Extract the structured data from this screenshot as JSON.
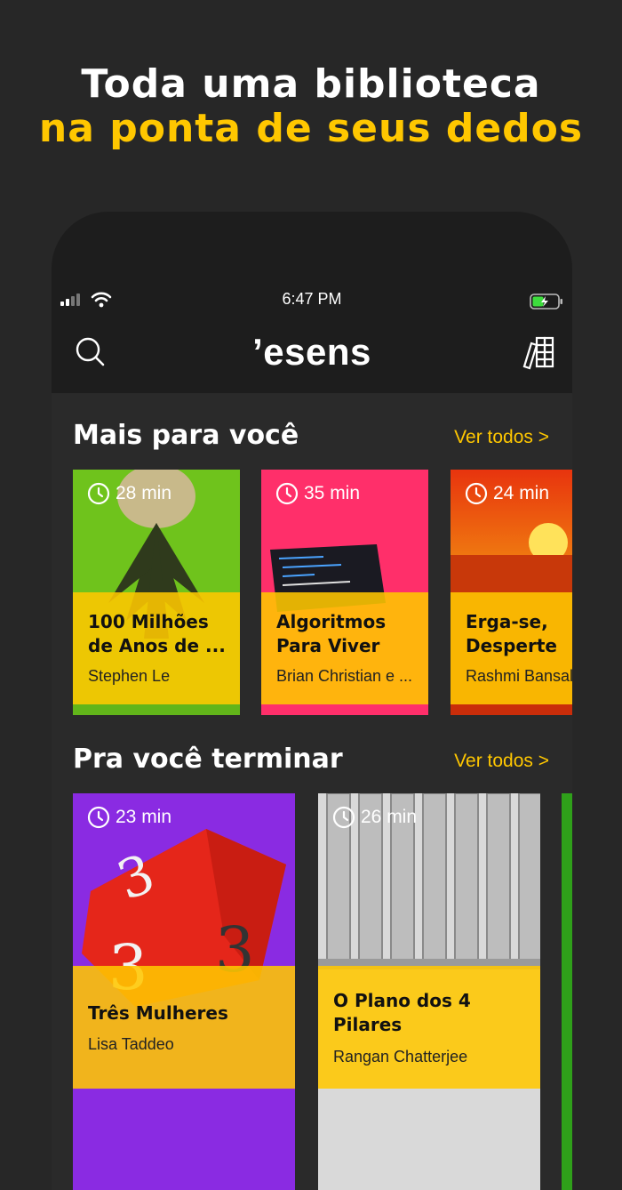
{
  "headline": {
    "line1": "Toda uma biblioteca",
    "line2": "na ponta de seus dedos"
  },
  "status_bar": {
    "time": "6:47 PM",
    "signal_icon": "cell-signal-icon",
    "wifi_icon": "wifi-icon",
    "battery_icon": "battery-charging-icon"
  },
  "app_bar": {
    "logo": "’esens",
    "search_icon": "search-icon",
    "library_icon": "library-books-icon"
  },
  "sections": [
    {
      "title": "Mais para você",
      "see_all": "Ver todos >",
      "cards": [
        {
          "duration": "28 min",
          "title": "100 Milhões\nde Anos de ...",
          "author": "Stephen Le",
          "cover": "#6fc31c",
          "bottom": "#62b51a"
        },
        {
          "duration": "35 min",
          "title": "Algoritmos\nPara Viver",
          "author": "Brian Christian e ...",
          "cover": "#ff2f6a",
          "bottom": "#ff2f6a"
        },
        {
          "duration": "24 min",
          "title": "Erga-se,\nDesperte",
          "author": "Rashmi Bansal",
          "cover": "#e23a10",
          "bottom": "#c92d0a"
        }
      ]
    },
    {
      "title": "Pra você terminar",
      "see_all": "Ver todos >",
      "cards": [
        {
          "duration": "23 min",
          "title": "Três Mulheres",
          "author": "Lisa Taddeo",
          "cover": "#8a2be2",
          "bottom": "#7b2bd8"
        },
        {
          "duration": "26 min",
          "title": "O Plano dos 4\nPilares",
          "author": "Rangan Chatterjee",
          "cover": "#d9d9d9",
          "bottom": "#d9d9d9"
        }
      ]
    }
  ]
}
